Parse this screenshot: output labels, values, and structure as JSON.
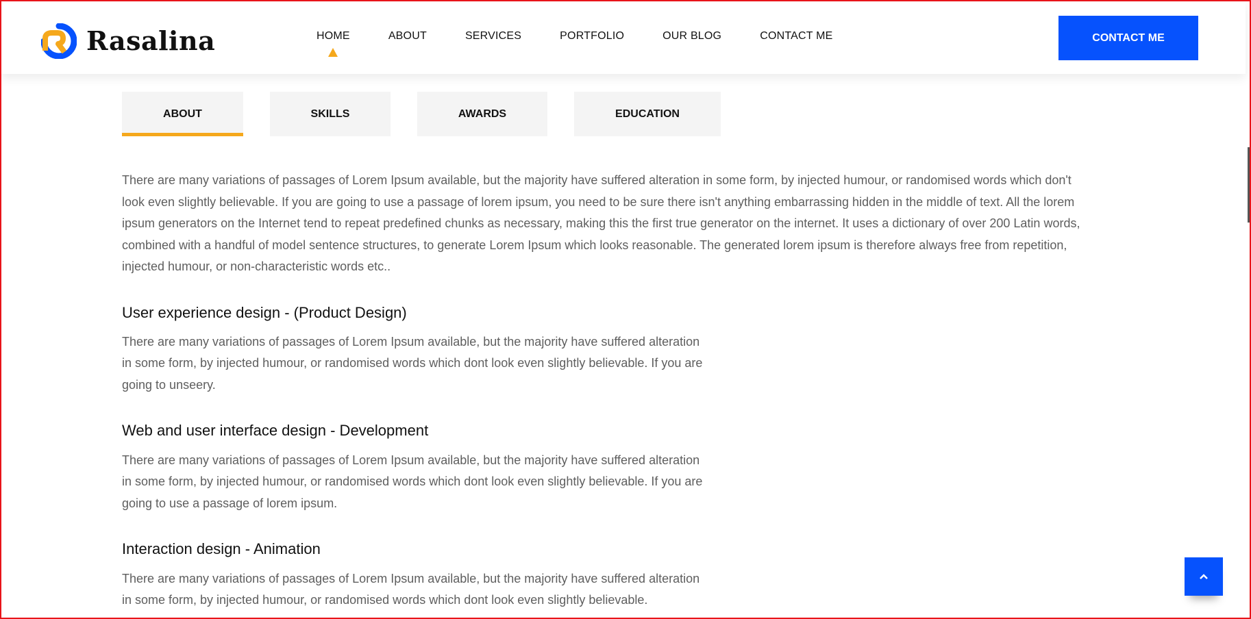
{
  "brand": {
    "name": "Rasalina",
    "logo_icon": "rasalina-r-logo-icon"
  },
  "nav": {
    "items": [
      {
        "label": "HOME",
        "active": true
      },
      {
        "label": "ABOUT"
      },
      {
        "label": "SERVICES"
      },
      {
        "label": "PORTFOLIO"
      },
      {
        "label": "OUR BLOG"
      },
      {
        "label": "CONTACT ME"
      }
    ],
    "active_indicator_color": "#f5a81c"
  },
  "cta": {
    "label": "CONTACT ME",
    "color": "#0652fd"
  },
  "tabs": [
    {
      "label": "ABOUT",
      "active": true
    },
    {
      "label": "SKILLS"
    },
    {
      "label": "AWARDS"
    },
    {
      "label": "EDUCATION"
    }
  ],
  "content": {
    "lead": "There are many variations of passages of Lorem Ipsum available, but the majority have suffered alteration in some form, by injected humour, or randomised words which don't look even slightly believable. If you are going to use a passage of lorem ipsum, you need to be sure there isn't anything embarrassing hidden in the middle of text. All the lorem ipsum generators on the Internet tend to repeat predefined chunks as necessary, making this the first true generator on the internet. It uses a dictionary of over 200 Latin words, combined with a handful of model sentence structures, to generate Lorem Ipsum which looks reasonable. The generated lorem ipsum is therefore always free from repetition, injected humour, or non-characteristic words etc..",
    "sections": [
      {
        "title": "User experience design - (Product Design)",
        "text": "There are many variations of passages of Lorem Ipsum available, but the majority have suffered alteration in some form, by injected humour, or randomised words which dont look even slightly believable. If you are going to unseery."
      },
      {
        "title": "Web and user interface design - Development",
        "text": "There are many variations of passages of Lorem Ipsum available, but the majority have suffered alteration in some form, by injected humour, or randomised words which dont look even slightly believable. If you are going to use a passage of lorem ipsum."
      },
      {
        "title": "Interaction design - Animation",
        "text": "There are many variations of passages of Lorem Ipsum available, but the majority have suffered alteration in some form, by injected humour, or randomised words which dont look even slightly believable."
      }
    ]
  },
  "back_to_top": {
    "icon": "chevron-up-icon"
  },
  "colors": {
    "accent": "#f5a81c",
    "primary": "#0652fd",
    "body_text": "#5e5e5e"
  }
}
